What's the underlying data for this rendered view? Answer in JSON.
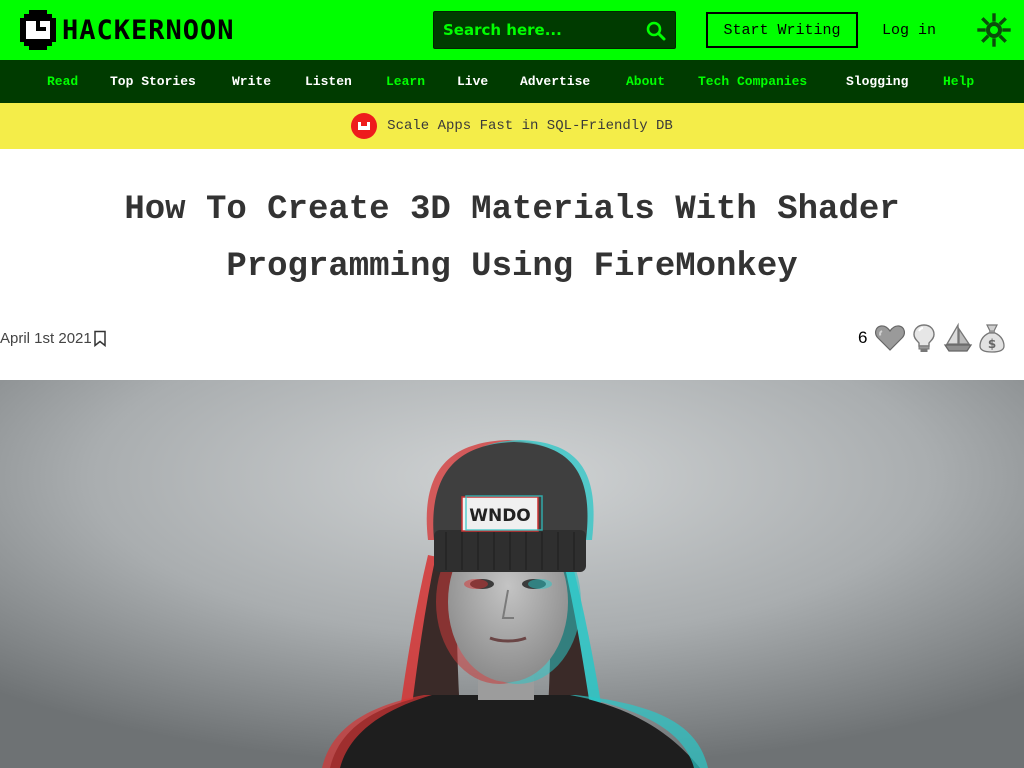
{
  "site": {
    "logo_text": "HACKERNOON",
    "search_placeholder": "Search here...",
    "start_writing": "Start Writing",
    "login": "Log in"
  },
  "nav": {
    "items": [
      "Read",
      "Top Stories",
      "Write",
      "Listen",
      "Learn",
      "Live",
      "Advertise",
      "About",
      "Tech Companies",
      "Slogging",
      "Help"
    ]
  },
  "promo": {
    "text": "Scale Apps Fast in SQL-Friendly DB"
  },
  "article": {
    "title_line1": "How To Create 3D Materials With Shader",
    "title_line2": "Programming Using FireMonkey",
    "date": "April 1st 2021",
    "reaction_count": "6",
    "reactions": [
      "heart-icon",
      "lightbulb-icon",
      "boat-icon",
      "money-bag-icon"
    ],
    "hero_image": {
      "subject": "woman-in-beanie-photo",
      "beanie_text": "WNDO",
      "style": "anaglyph"
    }
  },
  "colors": {
    "brand_green": "#00ff00",
    "dark_green": "#003b00",
    "promo_yellow": "#f4ed49",
    "title_text": "#333333"
  }
}
